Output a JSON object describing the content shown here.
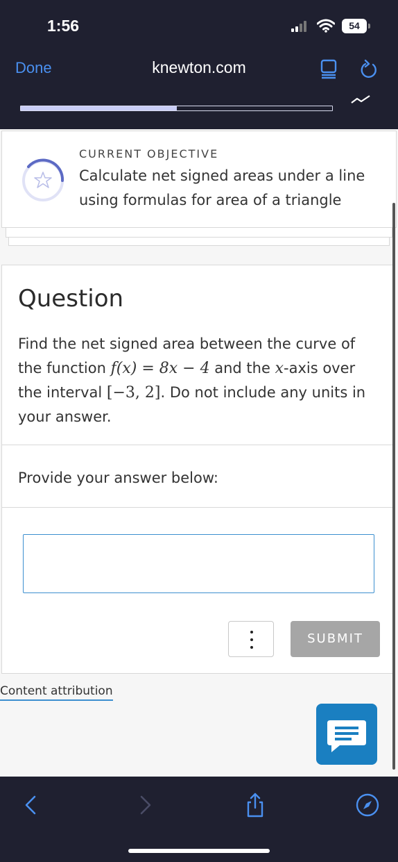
{
  "status": {
    "time": "1:56",
    "battery": "54"
  },
  "browser": {
    "done_label": "Done",
    "url": "knewton.com"
  },
  "progress": {
    "fraction": 0.5
  },
  "objective": {
    "label": "CURRENT OBJECTIVE",
    "text": "Calculate net signed areas under a line using formulas for area of a triangle"
  },
  "question": {
    "title": "Question",
    "intro": "Find the net signed area between the curve of the function ",
    "func": "f(x) = 8x − 4",
    "mid1": " and the ",
    "var": "x",
    "mid2": "-axis over the interval ",
    "interval": "[−3, 2]",
    "outro": ". Do not include any units in your answer."
  },
  "answer": {
    "prompt": "Provide your answer below:",
    "value": ""
  },
  "actions": {
    "submit_label": "SUBMIT"
  },
  "footer": {
    "attribution": "Content attribution"
  },
  "icons": {
    "reader": "reader-view-icon",
    "reload": "reload-icon",
    "trend": "trend-icon",
    "objective": "star-icon",
    "more": "more-vertical-icon",
    "chat": "chat-icon",
    "back": "back-icon",
    "forward": "forward-icon",
    "share": "share-icon",
    "compass": "compass-icon"
  },
  "colors": {
    "accent": "#1a7fc1",
    "link": "#4a90f0",
    "chrome": "#1f2030",
    "submit_disabled": "#a6a6a6"
  }
}
